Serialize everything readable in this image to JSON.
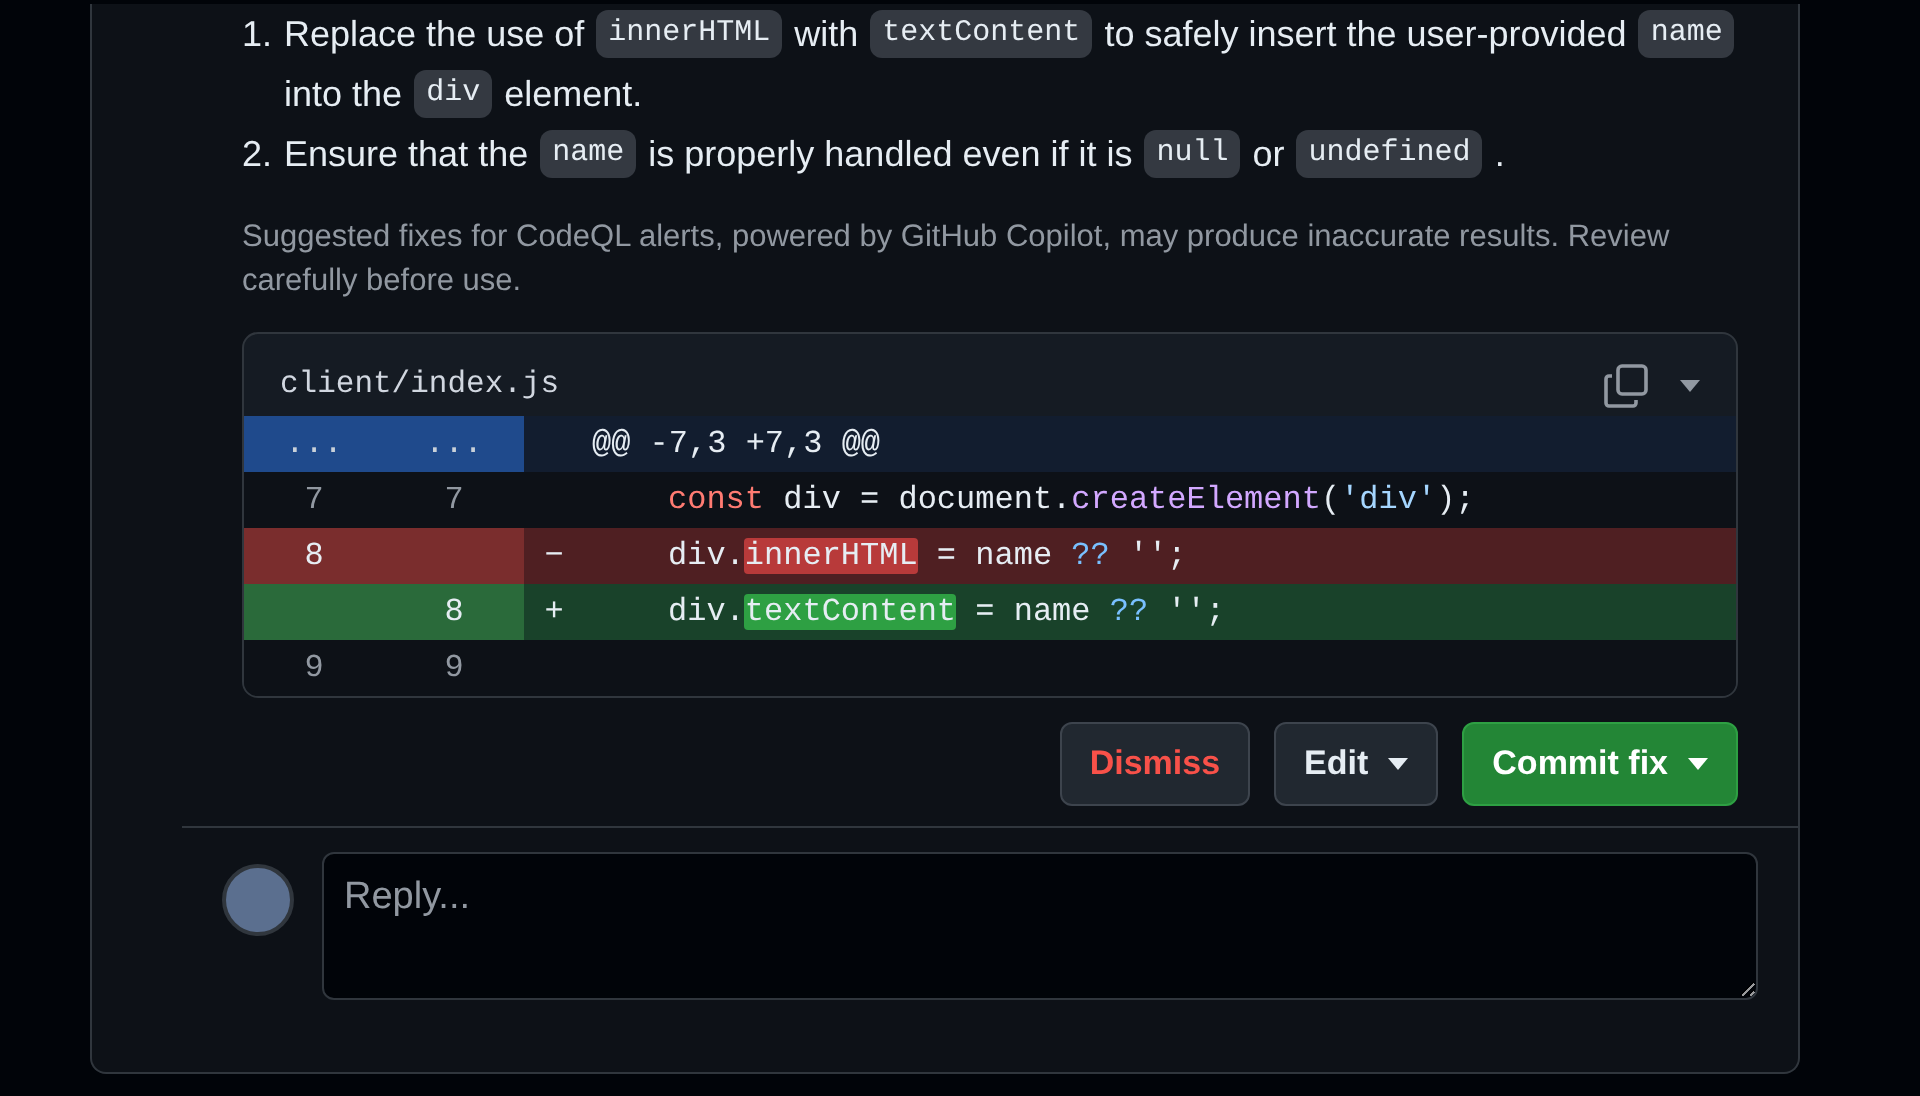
{
  "steps": [
    {
      "number": "1.",
      "segments": [
        {
          "kind": "text",
          "text": "Replace the use of"
        },
        {
          "kind": "code",
          "text": "innerHTML"
        },
        {
          "kind": "text",
          "text": "with"
        },
        {
          "kind": "code",
          "text": "textContent"
        },
        {
          "kind": "text",
          "text": "to safely insert the user-provided"
        },
        {
          "kind": "code",
          "text": "name"
        },
        {
          "kind": "text",
          "text": "into the"
        },
        {
          "kind": "code",
          "text": "div"
        },
        {
          "kind": "text",
          "text": "element."
        }
      ]
    },
    {
      "number": "2.",
      "segments": [
        {
          "kind": "text",
          "text": "Ensure that the"
        },
        {
          "kind": "code",
          "text": "name"
        },
        {
          "kind": "text",
          "text": "is properly handled even if it is"
        },
        {
          "kind": "code",
          "text": "null"
        },
        {
          "kind": "text",
          "text": "or"
        },
        {
          "kind": "code",
          "text": "undefined"
        },
        {
          "kind": "text",
          "text": "."
        }
      ]
    }
  ],
  "notice": "Suggested fixes for CodeQL alerts, powered by GitHub Copilot, may produce inaccurate results. Review carefully before use.",
  "diff": {
    "file": "client/index.js",
    "lines": [
      {
        "kind": "hunk",
        "old": "...",
        "new": "...",
        "tokens": [
          {
            "kind": "plain",
            "text": "@@ -7,3 +7,3 @@"
          }
        ]
      },
      {
        "kind": "context",
        "old": "7",
        "new": "7",
        "tokens": [
          {
            "kind": "keyword",
            "text": "const"
          },
          {
            "kind": "plain",
            "text": " div = document."
          },
          {
            "kind": "func",
            "text": "createElement"
          },
          {
            "kind": "plain",
            "text": "("
          },
          {
            "kind": "string",
            "text": "'div'"
          },
          {
            "kind": "plain",
            "text": ");"
          }
        ]
      },
      {
        "kind": "deletion",
        "old": "8",
        "sign": "−",
        "tokens": [
          {
            "kind": "plain",
            "text": "div."
          },
          {
            "kind": "changed",
            "text": "innerHTML"
          },
          {
            "kind": "plain",
            "text": " = name "
          },
          {
            "kind": "operator",
            "text": "??"
          },
          {
            "kind": "plain",
            "text": " '';"
          }
        ]
      },
      {
        "kind": "addition",
        "new": "8",
        "sign": "+",
        "tokens": [
          {
            "kind": "plain",
            "text": "div."
          },
          {
            "kind": "changed",
            "text": "textContent"
          },
          {
            "kind": "plain",
            "text": " = name "
          },
          {
            "kind": "operator",
            "text": "??"
          },
          {
            "kind": "plain",
            "text": " '';"
          }
        ]
      },
      {
        "kind": "context",
        "old": "9",
        "new": "9"
      }
    ]
  },
  "buttons": [
    {
      "kind": "danger",
      "label": "Dismiss",
      "dropdown": false
    },
    {
      "kind": "default",
      "label": "Edit",
      "dropdown": true
    },
    {
      "kind": "primary",
      "label": "Commit fix",
      "dropdown": true
    }
  ],
  "reply": {
    "placeholder": "Reply..."
  }
}
